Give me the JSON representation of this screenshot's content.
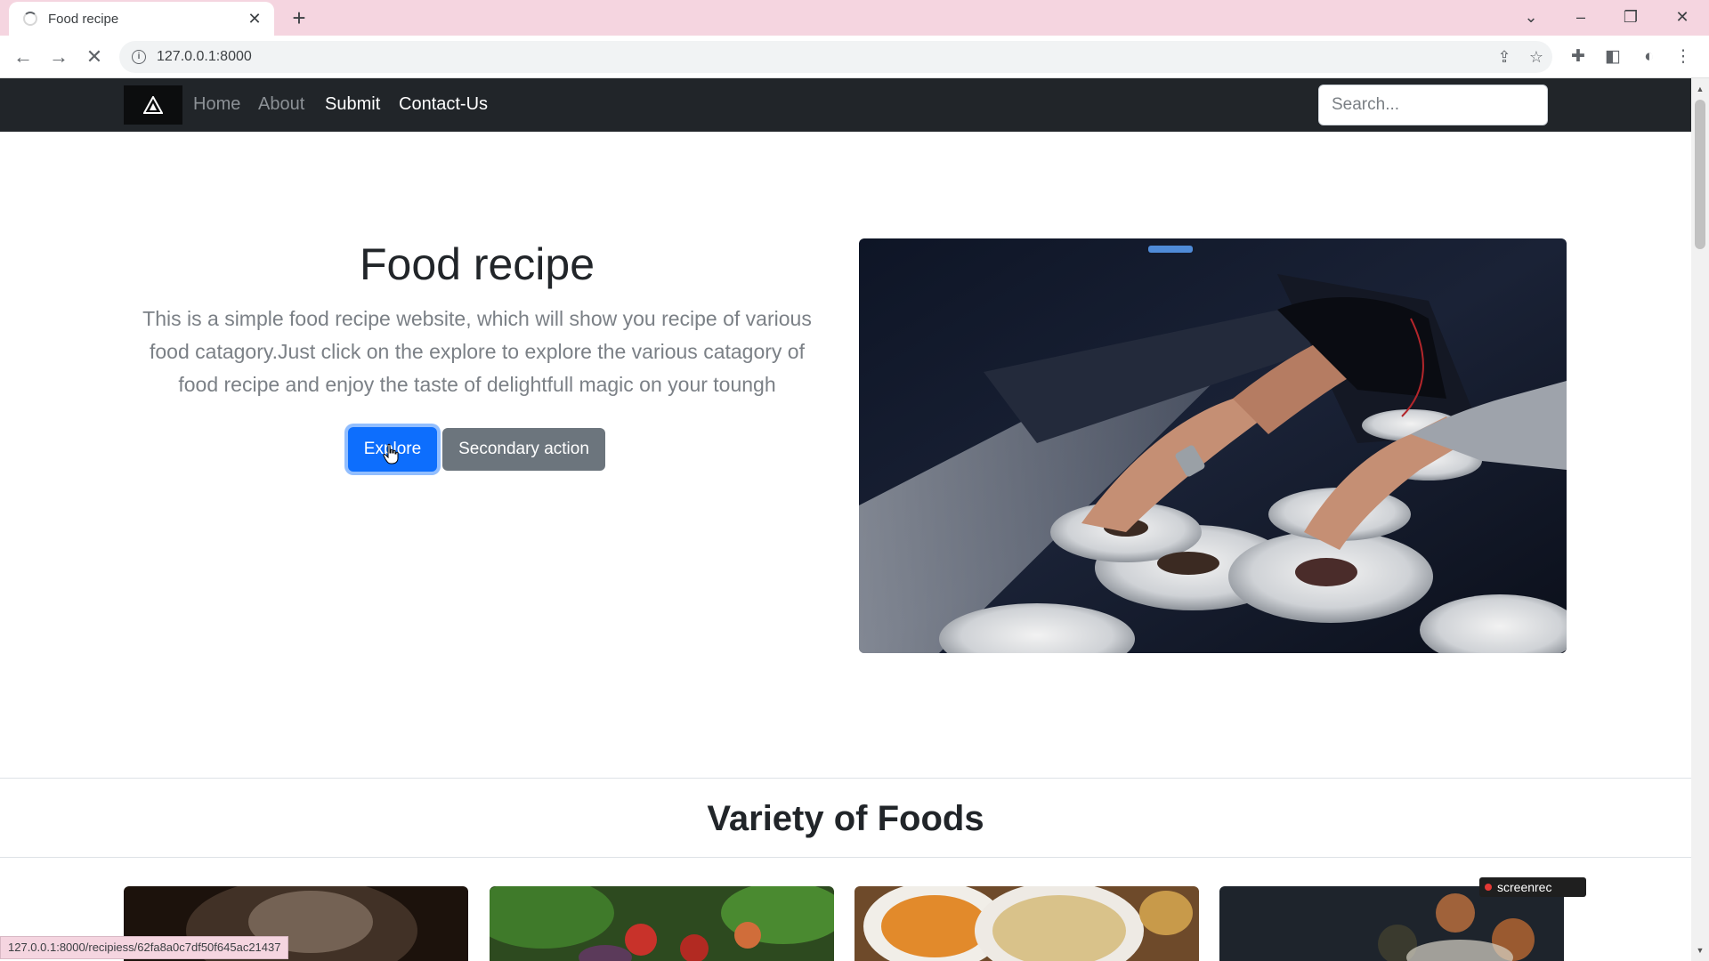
{
  "browser": {
    "tab_title": "Food recipe",
    "url": "127.0.0.1:8000",
    "status_url": "127.0.0.1:8000/recipiess/62fa8a0c7df50f645ac21437"
  },
  "navbar": {
    "links": [
      "Home",
      "About",
      "Submit",
      "Contact-Us"
    ],
    "search_placeholder": "Search..."
  },
  "hero": {
    "title": "Food recipe",
    "description": "This is a simple food recipe website, which will show you recipe of various food catagory.Just click on the explore to explore the various catagory of food recipe and enjoy the taste of delightfull magic on your toungh",
    "primary_button": "Explore",
    "secondary_button": "Secondary action"
  },
  "variety": {
    "title": "Variety of Foods"
  },
  "overlay": {
    "recorder_label": "screenrec"
  },
  "colors": {
    "navbar_bg": "#212529",
    "primary": "#0d6efd",
    "secondary": "#6c757d",
    "tabstrip": "#f5d5e0"
  }
}
